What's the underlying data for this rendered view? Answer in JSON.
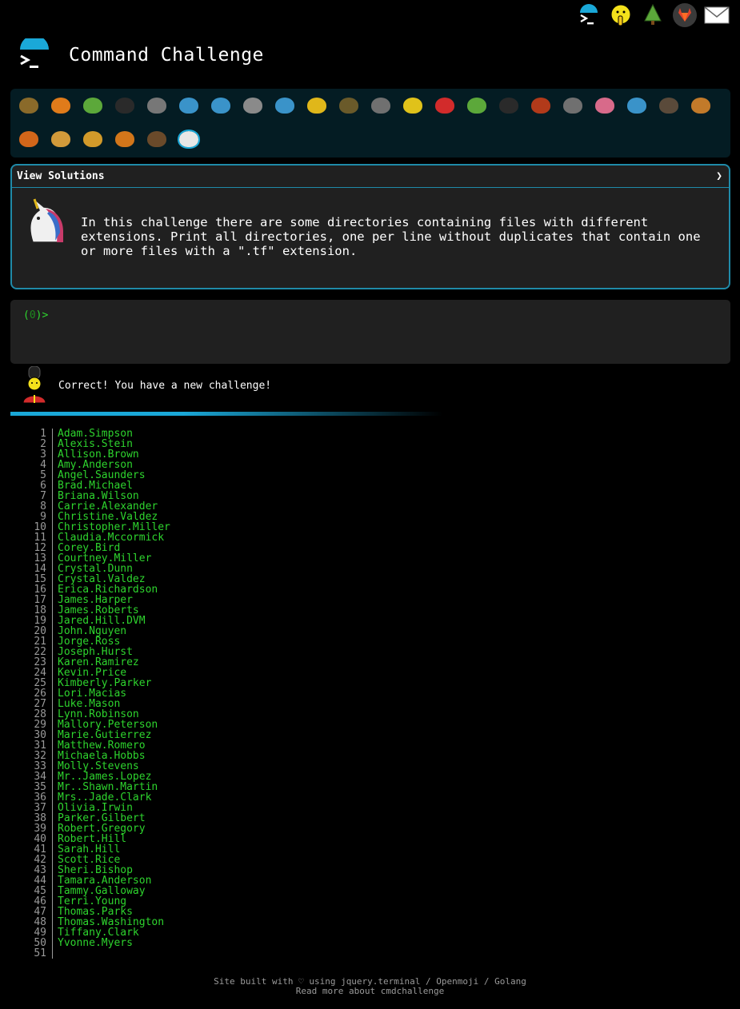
{
  "header": {
    "title": "Command Challenge"
  },
  "top_icons": [
    "terminal-logo-icon",
    "shush-face-icon",
    "tree-icon",
    "gitlab-icon",
    "mail-icon"
  ],
  "animals": [
    {
      "name": "snail",
      "color": "#8a6a2a"
    },
    {
      "name": "butterfly",
      "color": "#e07b1a"
    },
    {
      "name": "caterpillar",
      "color": "#5ca83a"
    },
    {
      "name": "ant",
      "color": "#2a2a2a"
    },
    {
      "name": "spider-web",
      "color": "#777777"
    },
    {
      "name": "whale",
      "color": "#3a93c9"
    },
    {
      "name": "shark",
      "color": "#3a93c9"
    },
    {
      "name": "dolphin",
      "color": "#8a8a8a"
    },
    {
      "name": "fish",
      "color": "#3a93c9"
    },
    {
      "name": "tropical-fish",
      "color": "#e0b71a"
    },
    {
      "name": "blowfish",
      "color": "#6a5a2a"
    },
    {
      "name": "wolf",
      "color": "#707070"
    },
    {
      "name": "bee",
      "color": "#e0c21a"
    },
    {
      "name": "ladybug",
      "color": "#d22b2b"
    },
    {
      "name": "cricket",
      "color": "#5ca83a"
    },
    {
      "name": "spider",
      "color": "#2a2a2a"
    },
    {
      "name": "scorpion",
      "color": "#b23a1a"
    },
    {
      "name": "fly",
      "color": "#707070"
    },
    {
      "name": "worm",
      "color": "#d86a8a"
    },
    {
      "name": "microbe",
      "color": "#3a93c9"
    },
    {
      "name": "gorilla",
      "color": "#5a4a3a"
    },
    {
      "name": "dog",
      "color": "#c27a2a"
    },
    {
      "name": "fox",
      "color": "#d2661a"
    },
    {
      "name": "cat",
      "color": "#d29a3a"
    },
    {
      "name": "lion",
      "color": "#d29a2a"
    },
    {
      "name": "tiger",
      "color": "#d2761a"
    },
    {
      "name": "horse",
      "color": "#6a4a2a"
    },
    {
      "name": "unicorn",
      "color": "#e6e6e6"
    }
  ],
  "solutions": {
    "toggle_label": "View Solutions",
    "arrow": "❯",
    "description": "In this challenge there are some directories containing files with different\nextensions. Print all directories, one per line without duplicates that contain one\nor more files with a \".tf\" extension."
  },
  "terminal": {
    "prompt_open": "(",
    "prompt_num": "0",
    "prompt_close": ")>"
  },
  "message": {
    "text": "Correct! You have a new challenge!"
  },
  "output_lines": [
    "Adam.Simpson",
    "Alexis.Stein",
    "Allison.Brown",
    "Amy.Anderson",
    "Angel.Saunders",
    "Brad.Michael",
    "Briana.Wilson",
    "Carrie.Alexander",
    "Christine.Valdez",
    "Christopher.Miller",
    "Claudia.Mccormick",
    "Corey.Bird",
    "Courtney.Miller",
    "Crystal.Dunn",
    "Crystal.Valdez",
    "Erica.Richardson",
    "James.Harper",
    "James.Roberts",
    "Jared.Hill.DVM",
    "John.Nguyen",
    "Jorge.Ross",
    "Joseph.Hurst",
    "Karen.Ramirez",
    "Kevin.Price",
    "Kimberly.Parker",
    "Lori.Macias",
    "Luke.Mason",
    "Lynn.Robinson",
    "Mallory.Peterson",
    "Marie.Gutierrez",
    "Matthew.Romero",
    "Michaela.Hobbs",
    "Molly.Stevens",
    "Mr..James.Lopez",
    "Mr..Shawn.Martin",
    "Mrs..Jade.Clark",
    "Olivia.Irwin",
    "Parker.Gilbert",
    "Robert.Gregory",
    "Robert.Hill",
    "Sarah.Hill",
    "Scott.Rice",
    "Sheri.Bishop",
    "Tamara.Anderson",
    "Tammy.Galloway",
    "Terri.Young",
    "Thomas.Parks",
    "Thomas.Washington",
    "Tiffany.Clark",
    "Yvonne.Myers",
    ""
  ],
  "footer": {
    "line1": "Site built with ♡ using jquery.terminal / Openmoji / Golang",
    "line2": "Read more about cmdchallenge"
  }
}
